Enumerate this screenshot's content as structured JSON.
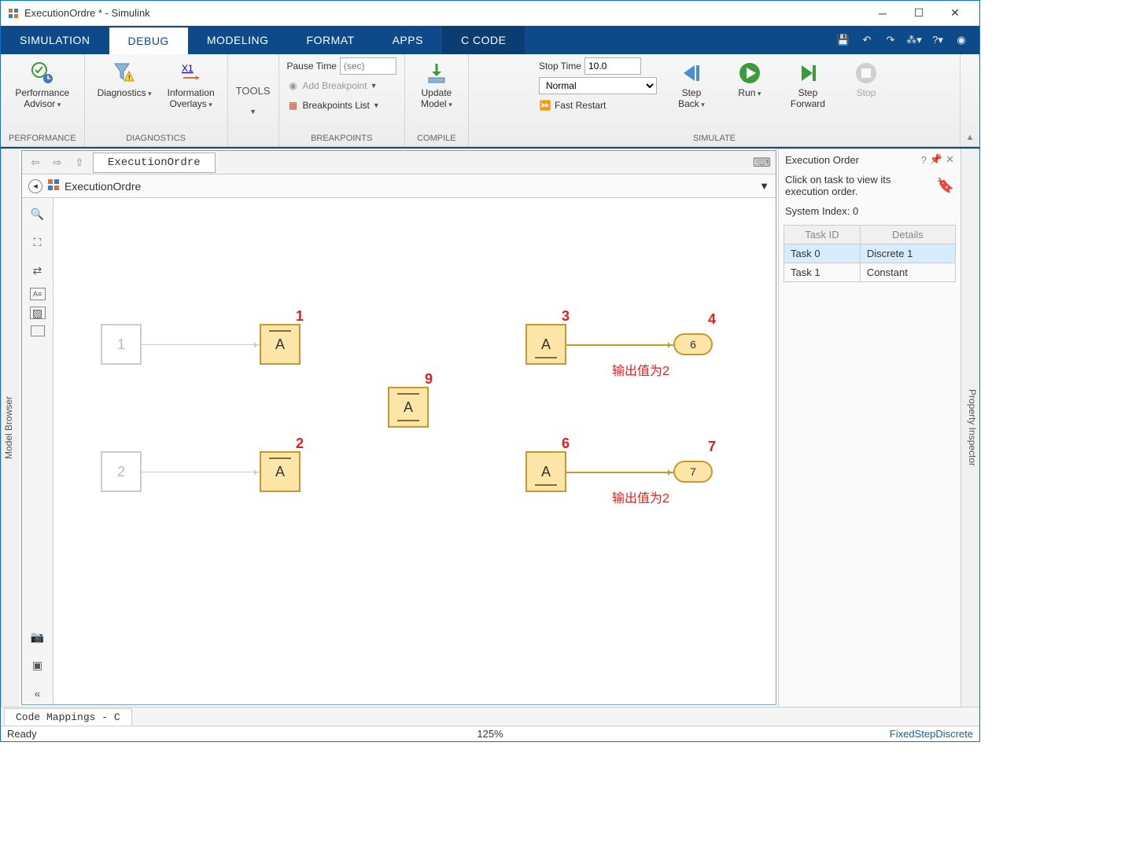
{
  "window": {
    "title": "ExecutionOrdre * - Simulink"
  },
  "tabs": [
    "SIMULATION",
    "DEBUG",
    "MODELING",
    "FORMAT",
    "APPS",
    "C CODE"
  ],
  "active_tab": "DEBUG",
  "ribbon": {
    "performance": {
      "label": "PERFORMANCE",
      "advisor": "Performance\nAdvisor"
    },
    "diagnostics": {
      "label": "DIAGNOSTICS",
      "diag": "Diagnostics",
      "overlays": "Information\nOverlays"
    },
    "tools": {
      "label": "TOOLS"
    },
    "breakpoints": {
      "label": "BREAKPOINTS",
      "pause_label": "Pause Time",
      "pause_placeholder": "(sec)",
      "add": "Add Breakpoint",
      "list": "Breakpoints List"
    },
    "compile": {
      "label": "COMPILE",
      "update": "Update\nModel"
    },
    "simulate": {
      "label": "SIMULATE",
      "stop_label": "Stop Time",
      "stop_value": "10.0",
      "mode": "Normal",
      "fast": "Fast Restart",
      "step_back": "Step\nBack",
      "run": "Run",
      "step_fwd": "Step\nForward",
      "stop": "Stop"
    }
  },
  "nav": {
    "tab": "ExecutionOrdre",
    "crumb": "ExecutionOrdre"
  },
  "exec_order": {
    "title": "Execution Order",
    "hint": "Click on task to view its execution order.",
    "system_index_label": "System Index:",
    "system_index": "0",
    "cols": [
      "Task ID",
      "Details"
    ],
    "rows": [
      {
        "id": "Task 0",
        "details": "Discrete 1",
        "selected": true
      },
      {
        "id": "Task 1",
        "details": "Constant",
        "selected": false
      }
    ]
  },
  "canvas": {
    "blocks": {
      "src1": "1",
      "src2": "2",
      "a1": "A",
      "a2": "A",
      "a3": "A",
      "a4": "A",
      "a5": "A",
      "d1": "6",
      "d2": "7"
    },
    "badges": {
      "b1": "1",
      "b2": "2",
      "b3": "3",
      "b4": "4",
      "b6": "6",
      "b7": "7",
      "b9": "9"
    },
    "annos": {
      "out1": "输出值为2",
      "out2": "输出值为2"
    }
  },
  "footer_tab": "Code Mappings - C",
  "status": {
    "left": "Ready",
    "mid": "125%",
    "right": "FixedStepDiscrete"
  },
  "side": {
    "left": "Model Browser",
    "right": "Property Inspector"
  }
}
